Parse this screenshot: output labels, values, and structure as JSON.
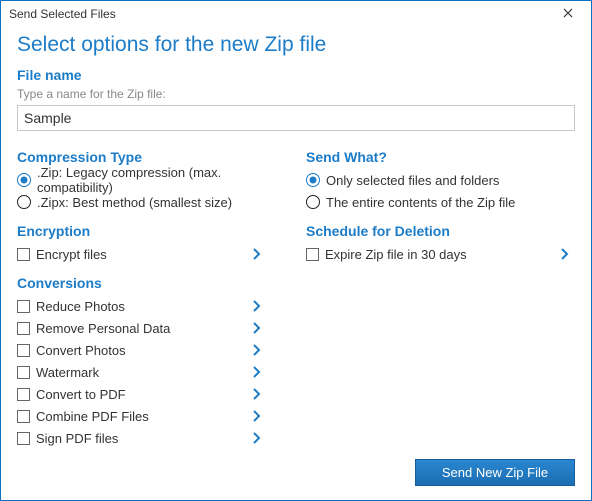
{
  "titlebar": {
    "title": "Send Selected Files"
  },
  "main_heading": "Select options for the new Zip file",
  "file_name": {
    "section_title": "File name",
    "hint": "Type a name for the Zip file:",
    "value": "Sample"
  },
  "compression": {
    "title": "Compression Type",
    "options": [
      ".Zip: Legacy compression (max. compatibility)",
      ".Zipx: Best method (smallest size)"
    ],
    "selected": 0
  },
  "send_what": {
    "title": "Send What?",
    "options": [
      "Only selected files and folders",
      "The entire contents of the Zip file"
    ],
    "selected": 0
  },
  "encryption": {
    "title": "Encryption",
    "label": "Encrypt files"
  },
  "schedule": {
    "title": "Schedule for Deletion",
    "label": "Expire Zip file in 30 days"
  },
  "conversions": {
    "title": "Conversions",
    "items": [
      "Reduce Photos",
      "Remove Personal Data",
      "Convert Photos",
      "Watermark",
      "Convert to PDF",
      "Combine PDF Files",
      "Sign PDF files"
    ]
  },
  "footer": {
    "primary": "Send New Zip File"
  }
}
